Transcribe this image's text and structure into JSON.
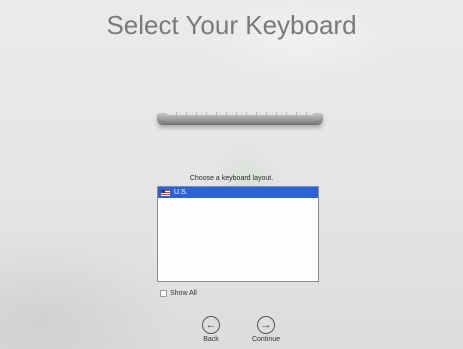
{
  "header": {
    "title": "Select Your Keyboard"
  },
  "layout_picker": {
    "prompt": "Choose a keyboard layout.",
    "items": [
      {
        "label": "U.S.",
        "icon": "us-flag-icon",
        "selected": true
      }
    ],
    "selection_color": "#2b62d6"
  },
  "show_all": {
    "label": "Show All",
    "checked": false
  },
  "navigation": {
    "back_label": "Back",
    "back_icon": "arrow-left-circle-icon",
    "continue_label": "Continue",
    "continue_icon": "arrow-right-circle-icon"
  }
}
